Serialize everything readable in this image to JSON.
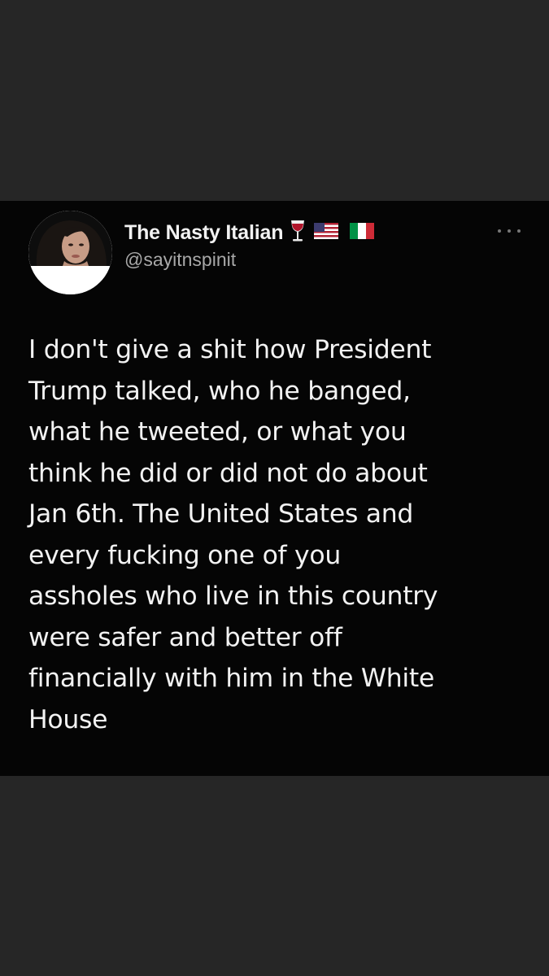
{
  "tweet": {
    "display_name": "The Nasty Italian",
    "handle": "@sayitnspinit",
    "emojis": [
      "wine-glass-icon",
      "us-flag-icon",
      "italy-flag-icon"
    ],
    "body": "I don't give a shit how President\nTrump talked, who he banged,\nwhat he tweeted, or what you\nthink he did or did not do about\nJan 6th. The United States and\nevery fucking one of you\nassholes who live in this country\nwere safer and better off\nfinancially with him in the White\nHouse"
  },
  "colors": {
    "page_background": "#262626",
    "card_background": "#050505",
    "text_primary": "#f2f2f2",
    "text_secondary": "#a8a8a8"
  }
}
